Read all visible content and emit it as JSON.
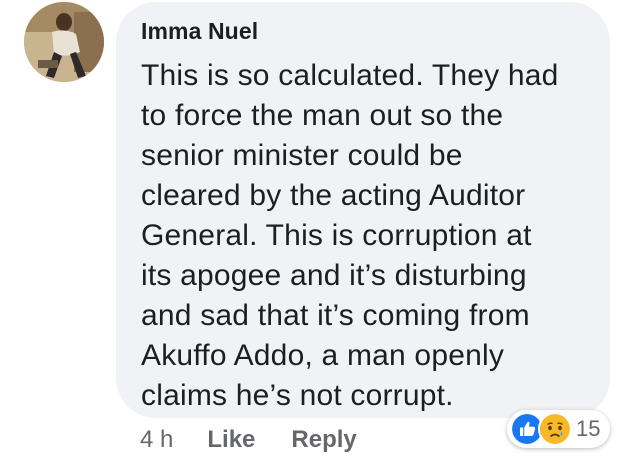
{
  "comment": {
    "author": "Imma Nuel",
    "text": "This is so calculated. They had\nto force the man out so the\nsenior minister could be\ncleared by the acting Auditor\nGeneral. This is corruption at\nits apogee and it’s disturbing\nand sad that it’s coming from\nAkuffo Addo, a man openly\nclaims he’s not corrupt.",
    "time": "4 h",
    "like_label": "Like",
    "reply_label": "Reply"
  },
  "reactions": {
    "icons": [
      "like-reaction-icon",
      "sad-reaction-icon"
    ],
    "count": "15",
    "like_color": "#1877f2",
    "sad_color": "#f7b928"
  },
  "colors": {
    "bubble_bg": "#f0f2f5",
    "text": "#1c1e21",
    "secondary_text": "#65676b"
  }
}
